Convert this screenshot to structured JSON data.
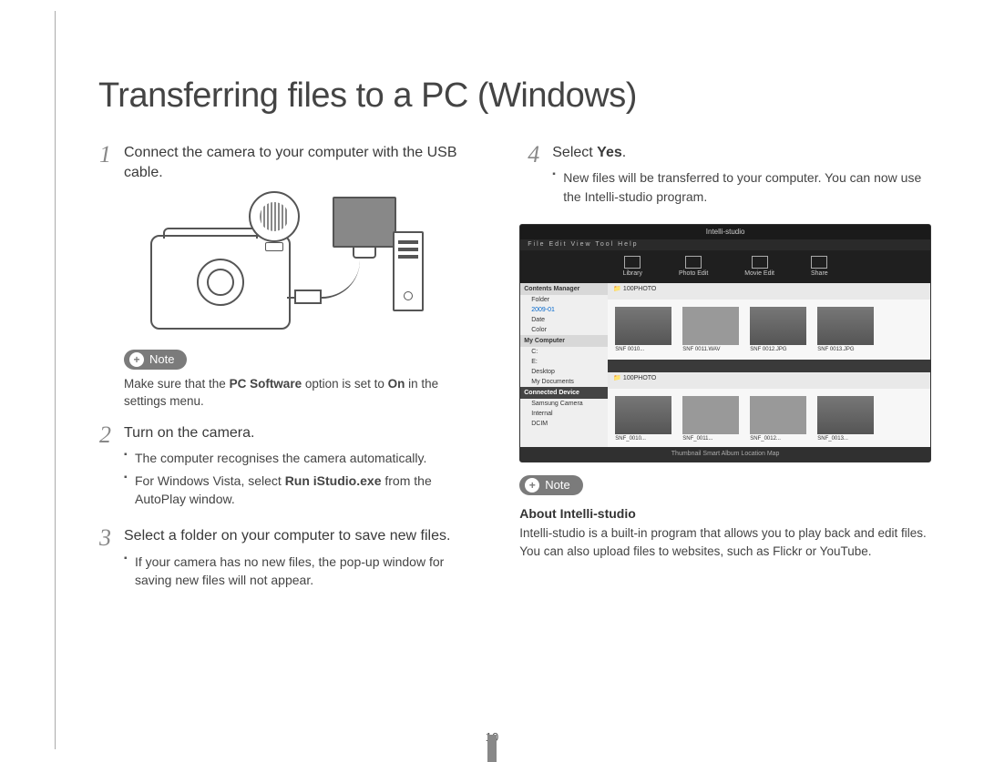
{
  "title": "Transferring files to a PC (Windows)",
  "page_number": "10",
  "left": {
    "step1": {
      "num": "1",
      "text_a": "Connect the camera to your computer with the USB cable."
    },
    "note1": {
      "label": "Note",
      "text_pre": "Make sure that the ",
      "bold1": "PC Software",
      "text_mid": " option is set to ",
      "bold2": "On",
      "text_post": " in the settings menu."
    },
    "step2": {
      "num": "2",
      "text": "Turn on the camera.",
      "b1": "The computer recognises the camera automatically.",
      "b2_pre": "For Windows Vista, select ",
      "b2_bold": "Run iStudio.exe",
      "b2_post": " from the AutoPlay window."
    },
    "step3": {
      "num": "3",
      "text": "Select a folder on your computer to save new files.",
      "b1": "If your camera has no new files, the pop-up window for saving new files will not appear."
    }
  },
  "right": {
    "step4": {
      "num": "4",
      "text_pre": "Select ",
      "bold": "Yes",
      "text_post": ".",
      "b1": "New files will be transferred to your computer. You can now use the Intelli-studio program."
    },
    "shot": {
      "title": "Intelli-studio",
      "menu": "File  Edit  View  Tool  Help",
      "tools": {
        "a": "Library",
        "b": "Photo Edit",
        "c": "Movie Edit",
        "d": "Share"
      },
      "side": {
        "h1": "Contents Manager",
        "i1": "Folder",
        "i2": "2009-01",
        "i3": "Date",
        "i4": "Color",
        "h2": "My Computer",
        "i5": "C:",
        "i6": "E:",
        "i7": "Desktop",
        "i8": "My Documents",
        "h3": "Connected Device",
        "i9": "Samsung Camera",
        "i10": "Internal",
        "i11": "DCIM"
      },
      "path1": "100PHOTO",
      "path2": "100PHOTO",
      "thumbs1": {
        "a": "SNF 0010...",
        "b": "SNF 0011.WAV",
        "c": "SNF 0012.JPG",
        "d": "SNF 0013.JPG"
      },
      "thumbs2": {
        "a": "SNF_0010...",
        "b": "SNF_0011...",
        "c": "SNF_0012...",
        "d": "SNF_0013..."
      },
      "bottom": "Thumbnail   Smart Album   Location Map"
    },
    "note": {
      "label": "Note",
      "subhead": "About Intelli-studio",
      "text": "Intelli-studio is a built-in program that allows you to play back and edit files. You can also upload files to websites, such as Flickr or YouTube."
    }
  }
}
